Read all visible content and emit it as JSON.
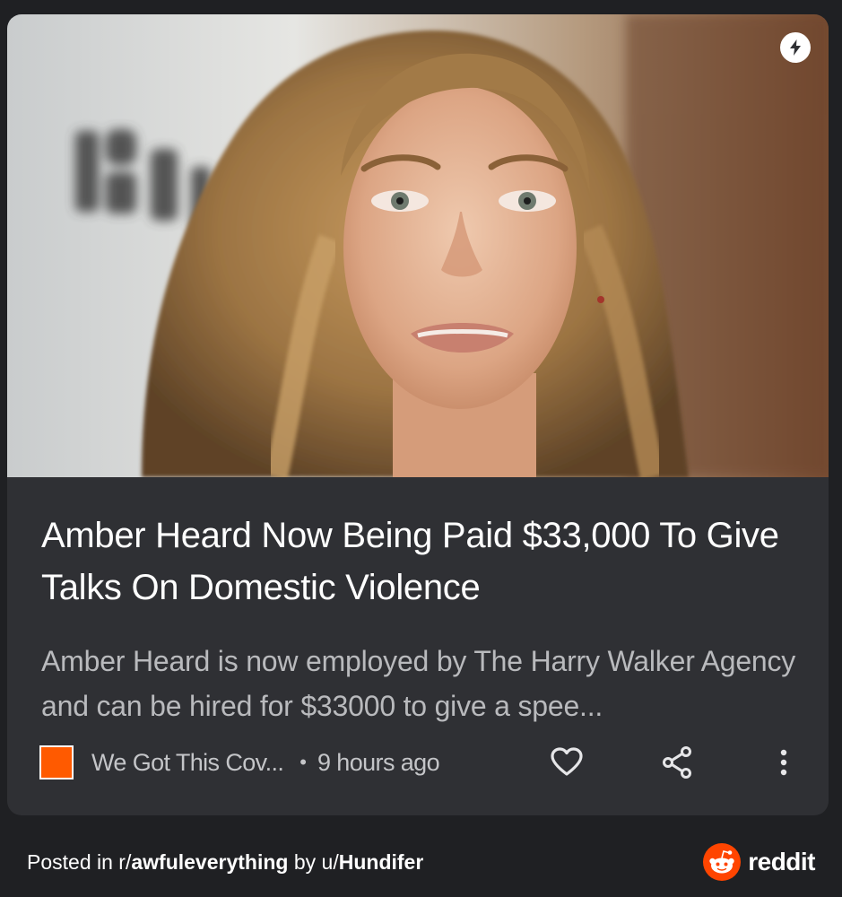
{
  "article": {
    "headline": "Amber Heard Now Being Paid $33,000 To Give Talks On Domestic Violence",
    "snippet": "Amber Heard is now employed by The Harry Walker Agency and can be hired for $33000 to give a spee...",
    "image_icon": "amp-lightning-icon"
  },
  "meta": {
    "source": "We Got This Cov...",
    "separator": "•",
    "time_ago": "9 hours ago",
    "actions": [
      "heart-icon",
      "share-icon",
      "more-vertical-icon"
    ]
  },
  "footer": {
    "prefix": "Posted in ",
    "subreddit_prefix": "r/",
    "subreddit": "awfuleverything",
    "by": " by u/",
    "user": "Hundifer",
    "brand": "reddit"
  },
  "colors": {
    "background": "#1f2023",
    "card": "#2f3034",
    "source_logo": "#ff5a00",
    "reddit_orange": "#ff4500"
  }
}
